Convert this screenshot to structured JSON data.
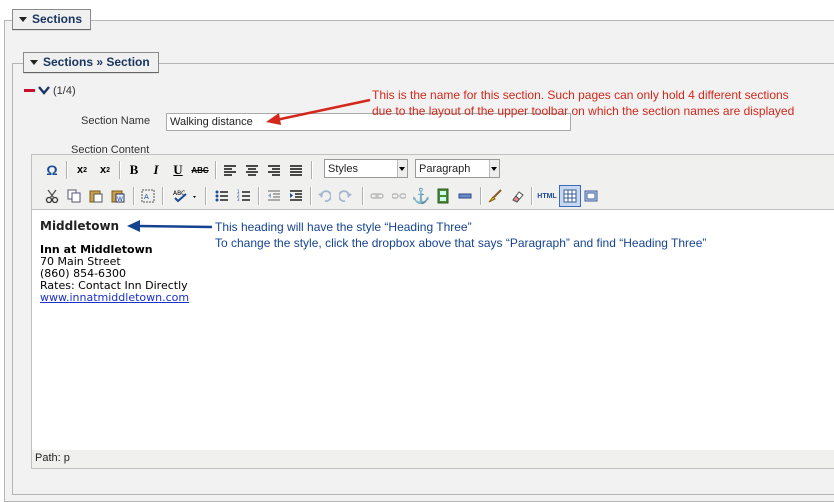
{
  "sections_legend": "Sections",
  "section_legend": "Sections » Section",
  "counter": "(1/4)",
  "section_name": {
    "label": "Section Name",
    "value": "Walking distance"
  },
  "section_content_label": "Section Content",
  "toolbar": {
    "styles_select": "Styles",
    "format_select": "Paragraph",
    "html_button": "HTML"
  },
  "content": {
    "heading": "Middletown",
    "inn_name": "Inn at Middletown",
    "address": "70 Main Street",
    "phone": "(860) 854-6300",
    "rates": "Rates: Contact Inn Directly",
    "link": "www.innatmiddletown.com"
  },
  "path": "Path: p",
  "annotations": {
    "red_line1": "This is the name for this section. Such pages can only hold 4 different sections",
    "red_line2": "due to the layout of the upper toolbar on which the section names are displayed",
    "blue_line1": "This heading will have the style “Heading Three”",
    "blue_line2": "To change the style, click the dropbox above that says “Paragraph” and find “Heading Three”"
  },
  "colors": {
    "annotation_red": "#d3281b",
    "annotation_blue": "#15438f",
    "legend_text": "#1a3560"
  }
}
